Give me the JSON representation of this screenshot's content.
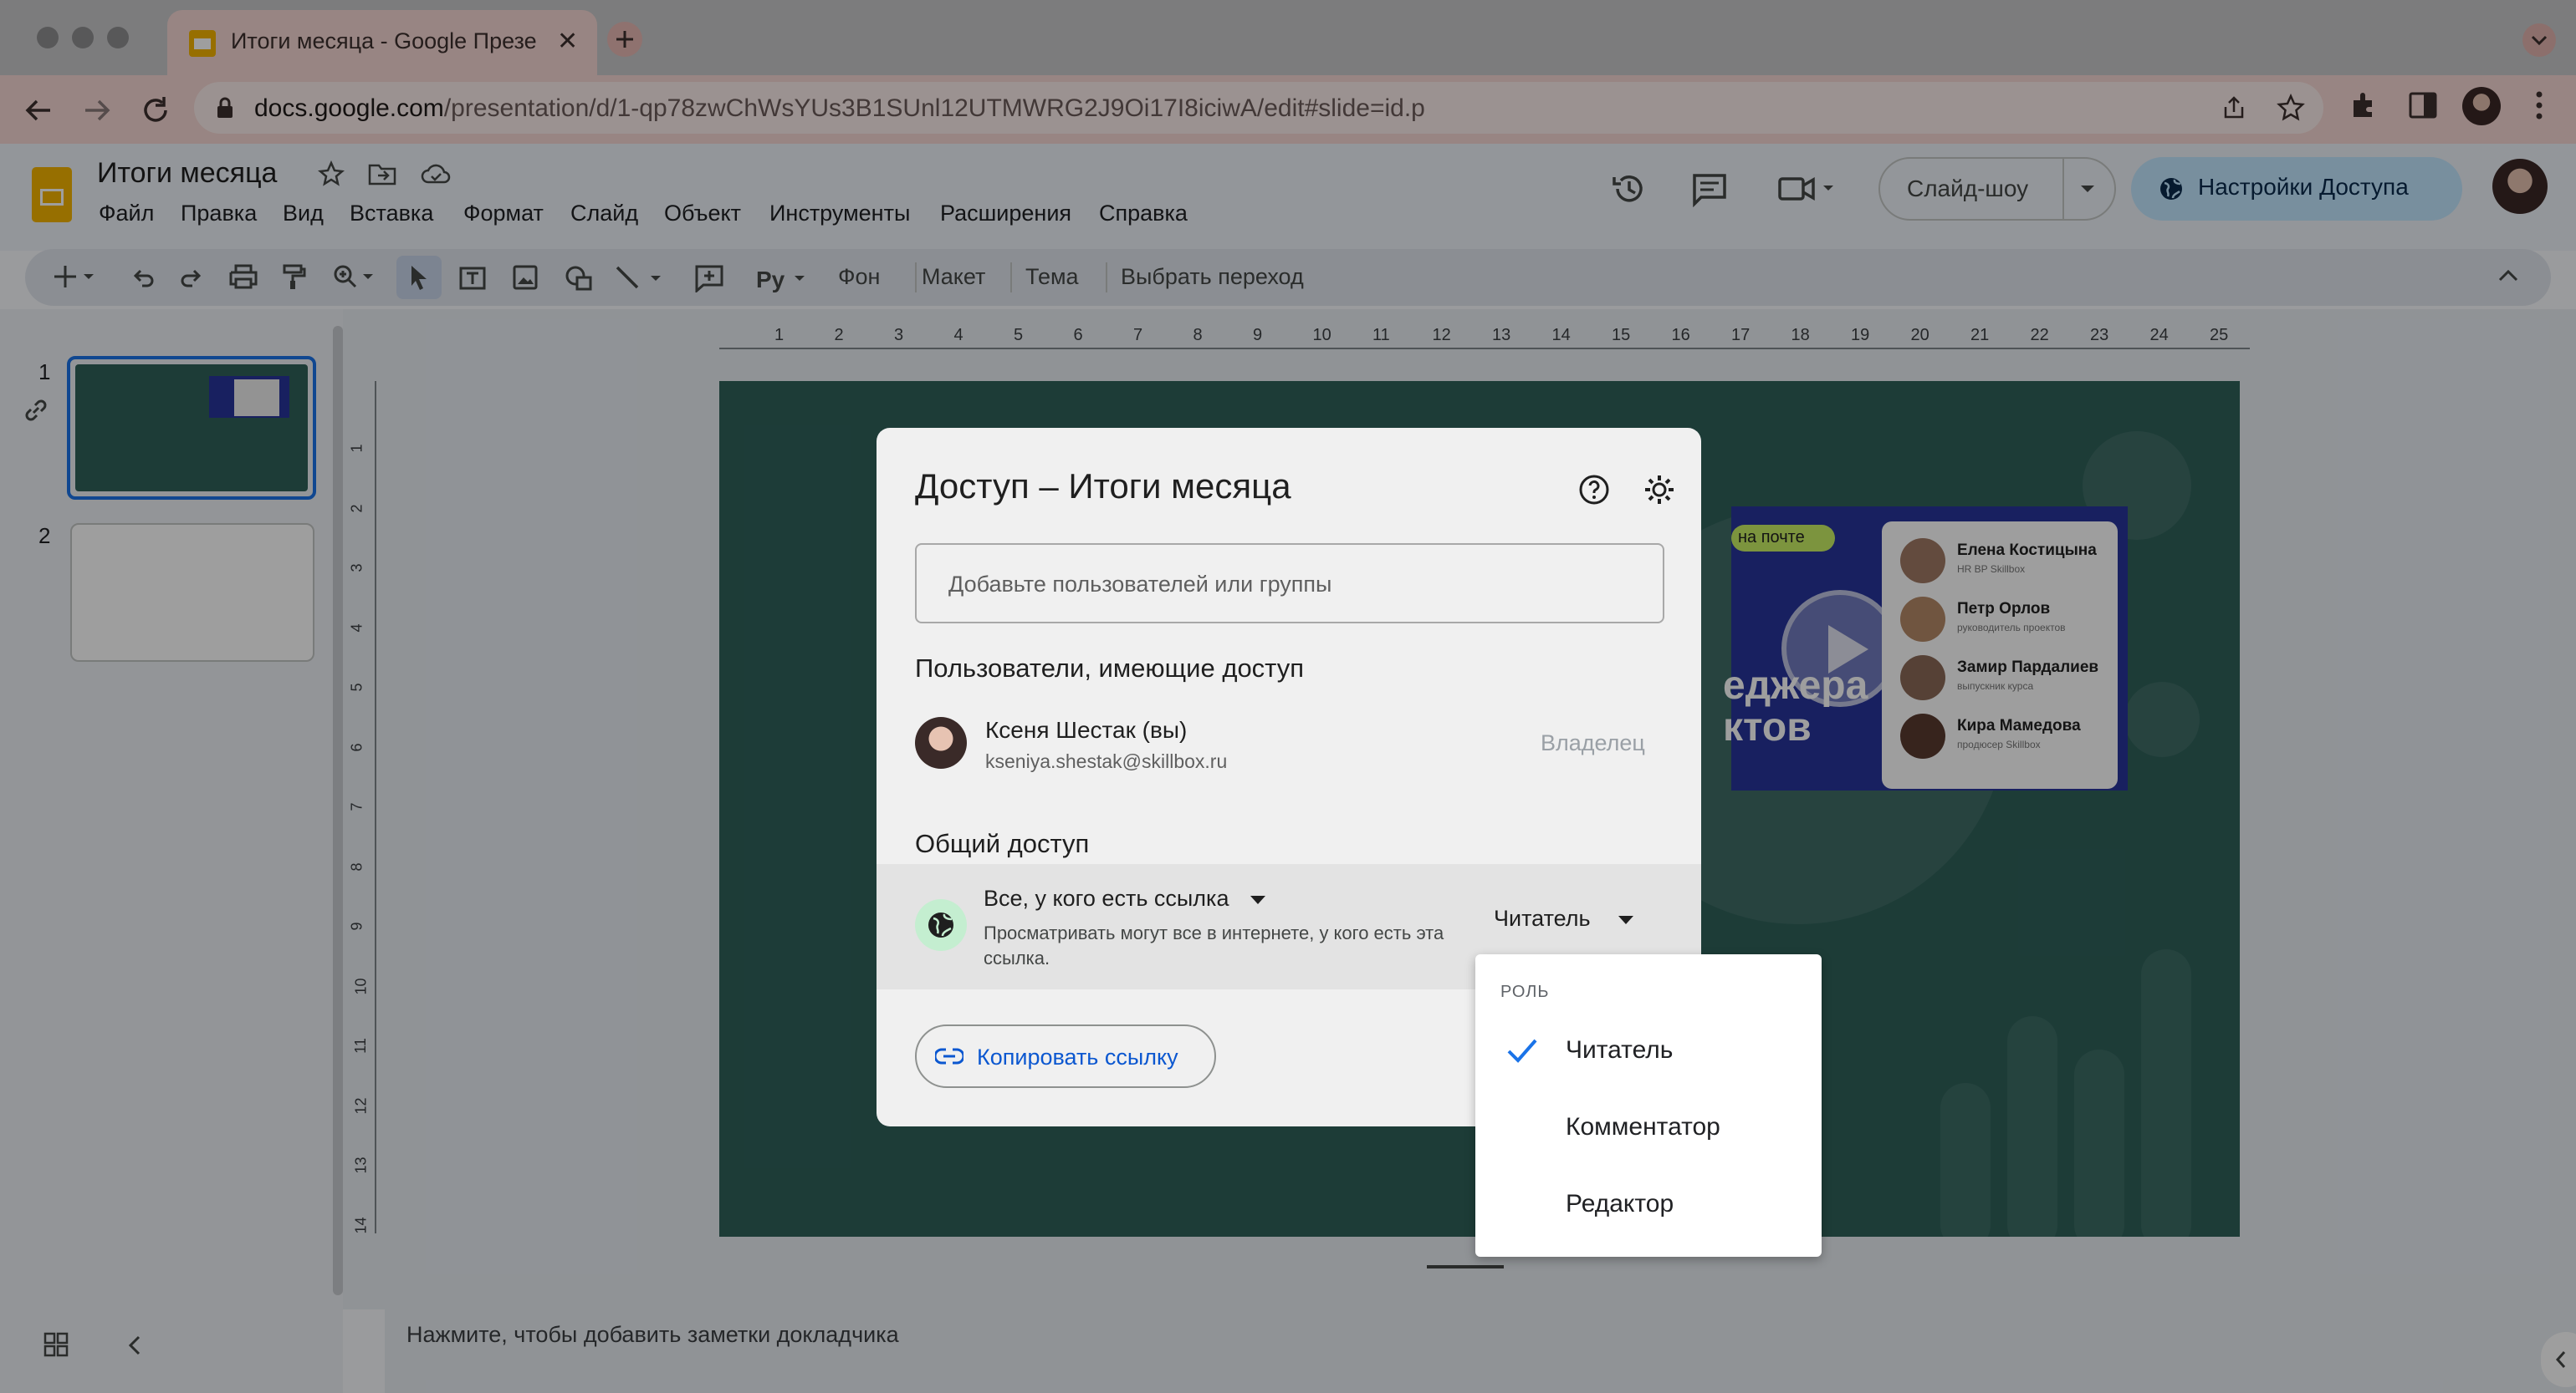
{
  "browser": {
    "tab_title": "Итоги месяца - Google Презе",
    "url_domain": "docs.google.com",
    "url_path": "/presentation/d/1-qp78zwChWsYUs3B1SUnl12UTMWRG2J9Oi17I8iciwA/edit#slide=id.p"
  },
  "app": {
    "doc_title": "Итоги месяца",
    "menu": [
      "Файл",
      "Правка",
      "Вид",
      "Вставка",
      "Формат",
      "Слайд",
      "Объект",
      "Инструменты",
      "Расширения",
      "Справка"
    ],
    "slideshow_label": "Слайд-шоу",
    "share_label": "Настройки Доступа",
    "toolbar": {
      "bg": "Фон",
      "layout": "Макет",
      "theme": "Тема",
      "transition": "Выбрать переход"
    },
    "slide_numbers": [
      "1",
      "2"
    ],
    "ruler_top": [
      "1",
      "2",
      "3",
      "4",
      "5",
      "6",
      "7",
      "8",
      "9",
      "10",
      "11",
      "12",
      "13",
      "14",
      "15",
      "16",
      "17",
      "18",
      "19",
      "20",
      "21",
      "22",
      "23",
      "24",
      "25"
    ],
    "ruler_left": [
      "1",
      "2",
      "3",
      "4",
      "5",
      "6",
      "7",
      "8",
      "9",
      "10",
      "11",
      "12",
      "13",
      "14"
    ],
    "notes_placeholder": "Нажмите, чтобы добавить заметки докладчика"
  },
  "slide": {
    "badge": "на почте",
    "title_lines": [
      "еджера",
      "ктов"
    ],
    "people": [
      {
        "name": "Елена Костицына",
        "role": "HR BP Skillbox"
      },
      {
        "name": "Петр Орлов",
        "role": "руководитель проектов"
      },
      {
        "name": "Замир Пардалиев",
        "role": "выпускник курса"
      },
      {
        "name": "Кира Мамедова",
        "role": "продюсер Skillbox"
      }
    ]
  },
  "dialog": {
    "title": "Доступ – Итоги месяца",
    "add_placeholder": "Добавьте пользователей или группы",
    "people_heading": "Пользователи, имеющие доступ",
    "user_name": "Ксеня Шестак (вы)",
    "user_email": "kseniya.shestak@skillbox.ru",
    "user_role": "Владелец",
    "general_heading": "Общий доступ",
    "link_scope": "Все, у кого есть ссылка",
    "link_desc": "Просматривать могут все в интернете, у кого есть эта ссылка.",
    "current_role": "Читатель",
    "copy_link": "Копировать ссылку"
  },
  "role_menu": {
    "heading": "РОЛЬ",
    "options": [
      "Читатель",
      "Комментатор",
      "Редактор"
    ],
    "selected": "Читатель"
  },
  "colors": {
    "accent": "#0b57d0",
    "share_button": "#c2e7ff",
    "slide_bg": "#2f615a",
    "tab_bg": "#f6d7d3"
  }
}
